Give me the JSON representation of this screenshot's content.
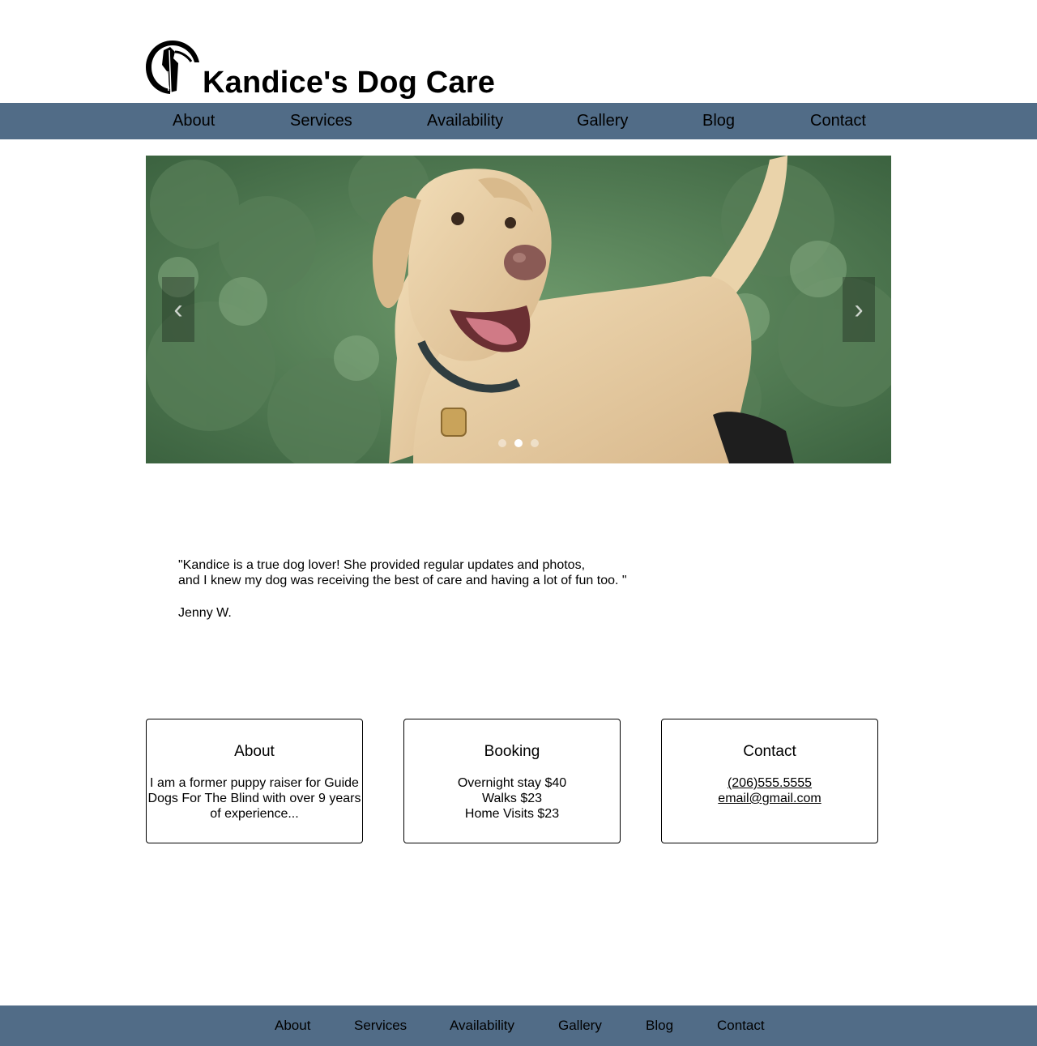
{
  "site": {
    "title": "Kandice's Dog Care",
    "logo_icon": "dog-silhouette-icon"
  },
  "nav": {
    "items": [
      {
        "label": "About"
      },
      {
        "label": "Services"
      },
      {
        "label": "Availability"
      },
      {
        "label": "Gallery"
      },
      {
        "label": "Blog"
      },
      {
        "label": "Contact"
      }
    ]
  },
  "slider": {
    "prev_icon": "chevron-left-icon",
    "next_icon": "chevron-right-icon",
    "prev_glyph": "‹",
    "next_glyph": "›",
    "slide_count": 3,
    "active_slide": 2
  },
  "testimonial": {
    "line1": "\"Kandice is a true dog lover! She provided regular updates and photos,",
    "line2": "and I knew my dog was receiving the best of care and having a lot of fun too. \"",
    "author": "Jenny W."
  },
  "cards": {
    "about": {
      "title": "About",
      "text": "I am a former puppy raiser for Guide Dogs For The Blind with over 9 years of experience..."
    },
    "booking": {
      "title": "Booking",
      "lines": [
        "Overnight stay $40",
        "Walks $23",
        "Home Visits $23"
      ]
    },
    "contact": {
      "title": "Contact",
      "phone": "(206)555.5555",
      "email": "email@gmail.com"
    }
  },
  "footer": {
    "items": [
      {
        "label": "About"
      },
      {
        "label": "Services"
      },
      {
        "label": "Availability"
      },
      {
        "label": "Gallery"
      },
      {
        "label": "Blog"
      },
      {
        "label": "Contact"
      }
    ]
  },
  "colors": {
    "nav_bg": "#516c87",
    "page_bg": "#ffffff",
    "text": "#000000"
  }
}
